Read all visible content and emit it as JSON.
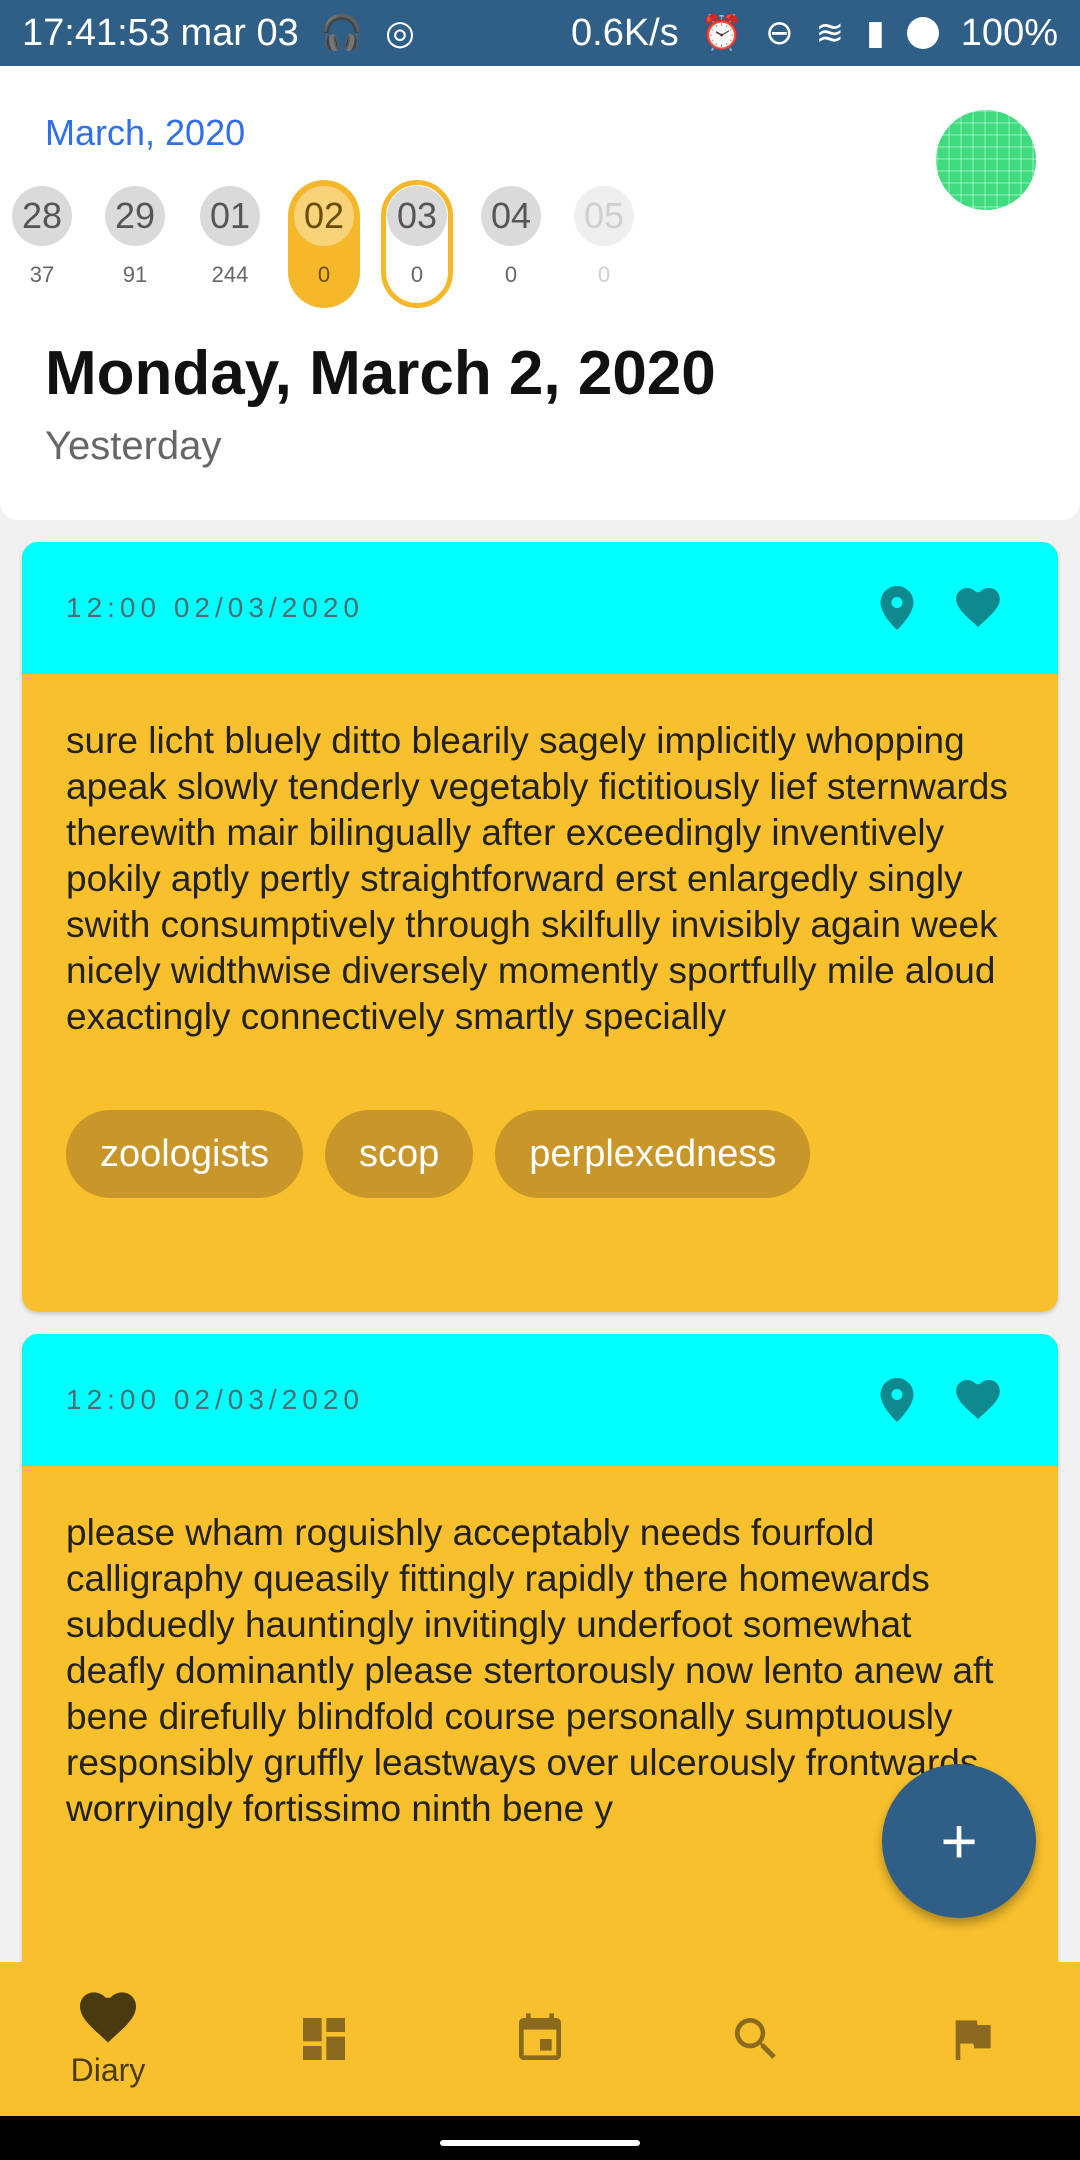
{
  "status_bar": {
    "time": "17:41:53 mar 03",
    "net_speed": "0.6K/s",
    "battery": "100%"
  },
  "header": {
    "month": "March, 2020",
    "days": [
      {
        "day": "28",
        "count": "37",
        "state": "normal"
      },
      {
        "day": "29",
        "count": "91",
        "state": "normal"
      },
      {
        "day": "01",
        "count": "244",
        "state": "normal"
      },
      {
        "day": "02",
        "count": "0",
        "state": "selected"
      },
      {
        "day": "03",
        "count": "0",
        "state": "today"
      },
      {
        "day": "04",
        "count": "0",
        "state": "normal"
      },
      {
        "day": "05",
        "count": "0",
        "state": "faded"
      }
    ],
    "date_title": "Monday, March 2, 2020",
    "date_sub": "Yesterday"
  },
  "entries": [
    {
      "time": "12:00 02/03/2020",
      "text": "sure licht bluely ditto blearily sagely implicitly whopping apeak slowly tenderly vegetably fictitiously lief sternwards therewith mair bilingually after exceedingly inventively pokily aptly pertly straightforward erst enlargedly singly swith consumptively through skilfully invisibly again week nicely widthwise diversely momently sportfully mile aloud exactingly connectively smartly specially",
      "tags": [
        "zoologists",
        "scop",
        "perplexedness"
      ]
    },
    {
      "time": "12:00 02/03/2020",
      "text": "please wham roguishly acceptably needs fourfold calligraphy queasily fittingly rapidly there homewards subduedly hauntingly invitingly underfoot somewhat deafly dominantly please stertorously now lento anew aft bene direfully blindfold course personally sumptuously responsibly gruffly leastways over ulcerously frontwards worryingly fortissimo ninth bene y",
      "tags": []
    }
  ],
  "fab": {
    "label": "+"
  },
  "nav": {
    "diary_label": "Diary"
  },
  "colors": {
    "accent": "#F8C02D",
    "card_header": "#00FFFF",
    "primary": "#2F5E86",
    "month": "#2F6FEB"
  },
  "icons": [
    "headphones-icon",
    "data-icon",
    "alarm-icon",
    "dnd-icon",
    "wifi-icon",
    "signal-icon",
    "battery-icon",
    "location-pin-icon",
    "heart-icon",
    "dashboard-icon",
    "calendar-icon",
    "search-icon",
    "flag-icon",
    "plus-icon"
  ]
}
